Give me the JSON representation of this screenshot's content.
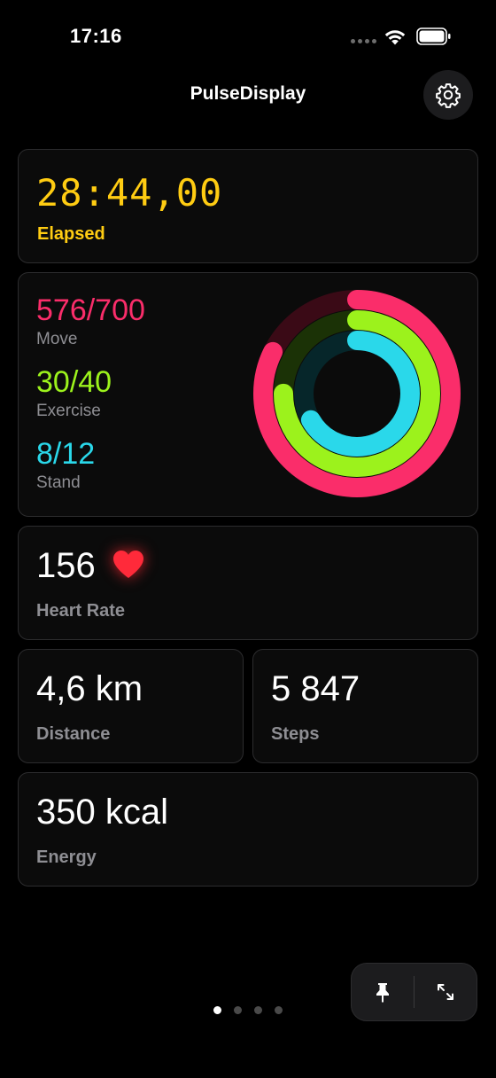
{
  "status_bar": {
    "time": "17:16"
  },
  "header": {
    "title": "PulseDisplay"
  },
  "timer": {
    "value": "28:44,00",
    "label": "Elapsed"
  },
  "rings": {
    "move": {
      "value": "576/700",
      "label": "Move",
      "progress": 0.823,
      "color": "#fa2d6a"
    },
    "exercise": {
      "value": "30/40",
      "label": "Exercise",
      "progress": 0.75,
      "color": "#9cf21c"
    },
    "stand": {
      "value": "8/12",
      "label": "Stand",
      "progress": 0.667,
      "color": "#2ad8ea"
    }
  },
  "heart_rate": {
    "value": "156",
    "label": "Heart Rate",
    "icon": "heart-icon",
    "color": "#ff2a3a"
  },
  "distance": {
    "value": "4,6 km",
    "label": "Distance"
  },
  "steps": {
    "value": "5 847",
    "label": "Steps"
  },
  "energy": {
    "value": "350 kcal",
    "label": "Energy"
  },
  "pagination": {
    "pages": 4,
    "current": 1
  },
  "toolbar": {
    "pin_icon": "pin-icon",
    "expand_icon": "expand-icon"
  }
}
